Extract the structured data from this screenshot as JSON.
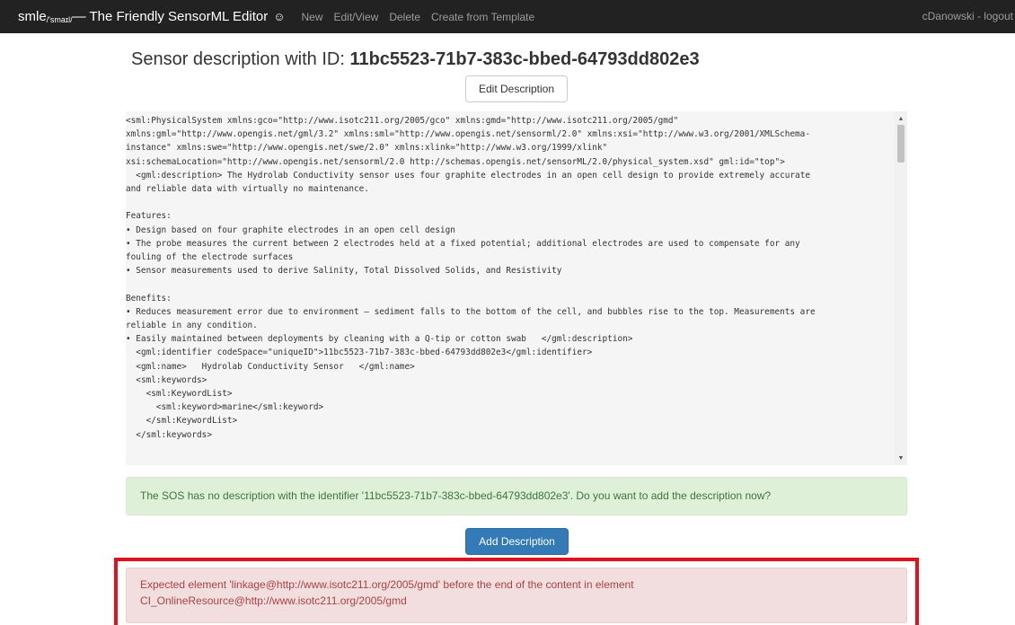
{
  "navbar": {
    "brand_main": "smle",
    "brand_sub": "/'smaɪl/",
    "brand_rest": " — The Friendly SensorML Editor",
    "brand_icon": "smiley-icon",
    "links": [
      "New",
      "Edit/View",
      "Delete",
      "Create from Template"
    ],
    "user": "cDanowski - logout",
    "bg_color": "#222222"
  },
  "heading": {
    "prefix": "Sensor description with ID: ",
    "id": "11bc5523-71b7-383c-bbed-64793dd802e3"
  },
  "edit_button": "Edit Description",
  "xml_content": "<sml:PhysicalSystem xmlns:gco=\"http://www.isotc211.org/2005/gco\" xmlns:gmd=\"http://www.isotc211.org/2005/gmd\"\nxmlns:gml=\"http://www.opengis.net/gml/3.2\" xmlns:sml=\"http://www.opengis.net/sensorml/2.0\" xmlns:xsi=\"http://www.w3.org/2001/XMLSchema-\ninstance\" xmlns:swe=\"http://www.opengis.net/swe/2.0\" xmlns:xlink=\"http://www.w3.org/1999/xlink\"\nxsi:schemaLocation=\"http://www.opengis.net/sensorml/2.0 http://schemas.opengis.net/sensorML/2.0/physical_system.xsd\" gml:id=\"top\">\n  <gml:description> The Hydrolab Conductivity sensor uses four graphite electrodes in an open cell design to provide extremely accurate\nand reliable data with virtually no maintenance.\n\nFeatures:\n• Design based on four graphite electrodes in an open cell design\n• The probe measures the current between 2 electrodes held at a fixed potential; additional electrodes are used to compensate for any\nfouling of the electrode surfaces\n• Sensor measurements used to derive Salinity, Total Dissolved Solids, and Resistivity\n\nBenefits:\n• Reduces measurement error due to environment – sediment falls to the bottom of the cell, and bubbles rise to the top. Measurements are\nreliable in any condition.\n• Easily maintained between deployments by cleaning with a Q-tip or cotton swab   </gml:description>\n  <gml:identifier codeSpace=\"uniqueID\">11bc5523-71b7-383c-bbed-64793dd802e3</gml:identifier>\n  <gml:name>   Hydrolab Conductivity Sensor   </gml:name>\n  <sml:keywords>\n    <sml:KeywordList>\n      <sml:keyword>marine</sml:keyword>\n    </sml:KeywordList>\n  </sml:keywords>",
  "success_alert": "The SOS has no description with the identifier '11bc5523-71b7-383c-bbed-64793dd802e3'. Do you want to add the description now?",
  "add_button": "Add Description",
  "error_alert": {
    "line1": "Expected element 'linkage@http://www.isotc211.org/2005/gmd' before the end of the content in element",
    "line2": "CI_OnlineResource@http://www.isotc211.org/2005/gmd"
  },
  "colors": {
    "primary": "#337ab7",
    "success_bg": "#dff0d8",
    "danger_bg": "#f2dede",
    "highlight": "#e0121d"
  },
  "scrollbar_icons": [
    "chevron-up-icon",
    "chevron-down-icon"
  ]
}
